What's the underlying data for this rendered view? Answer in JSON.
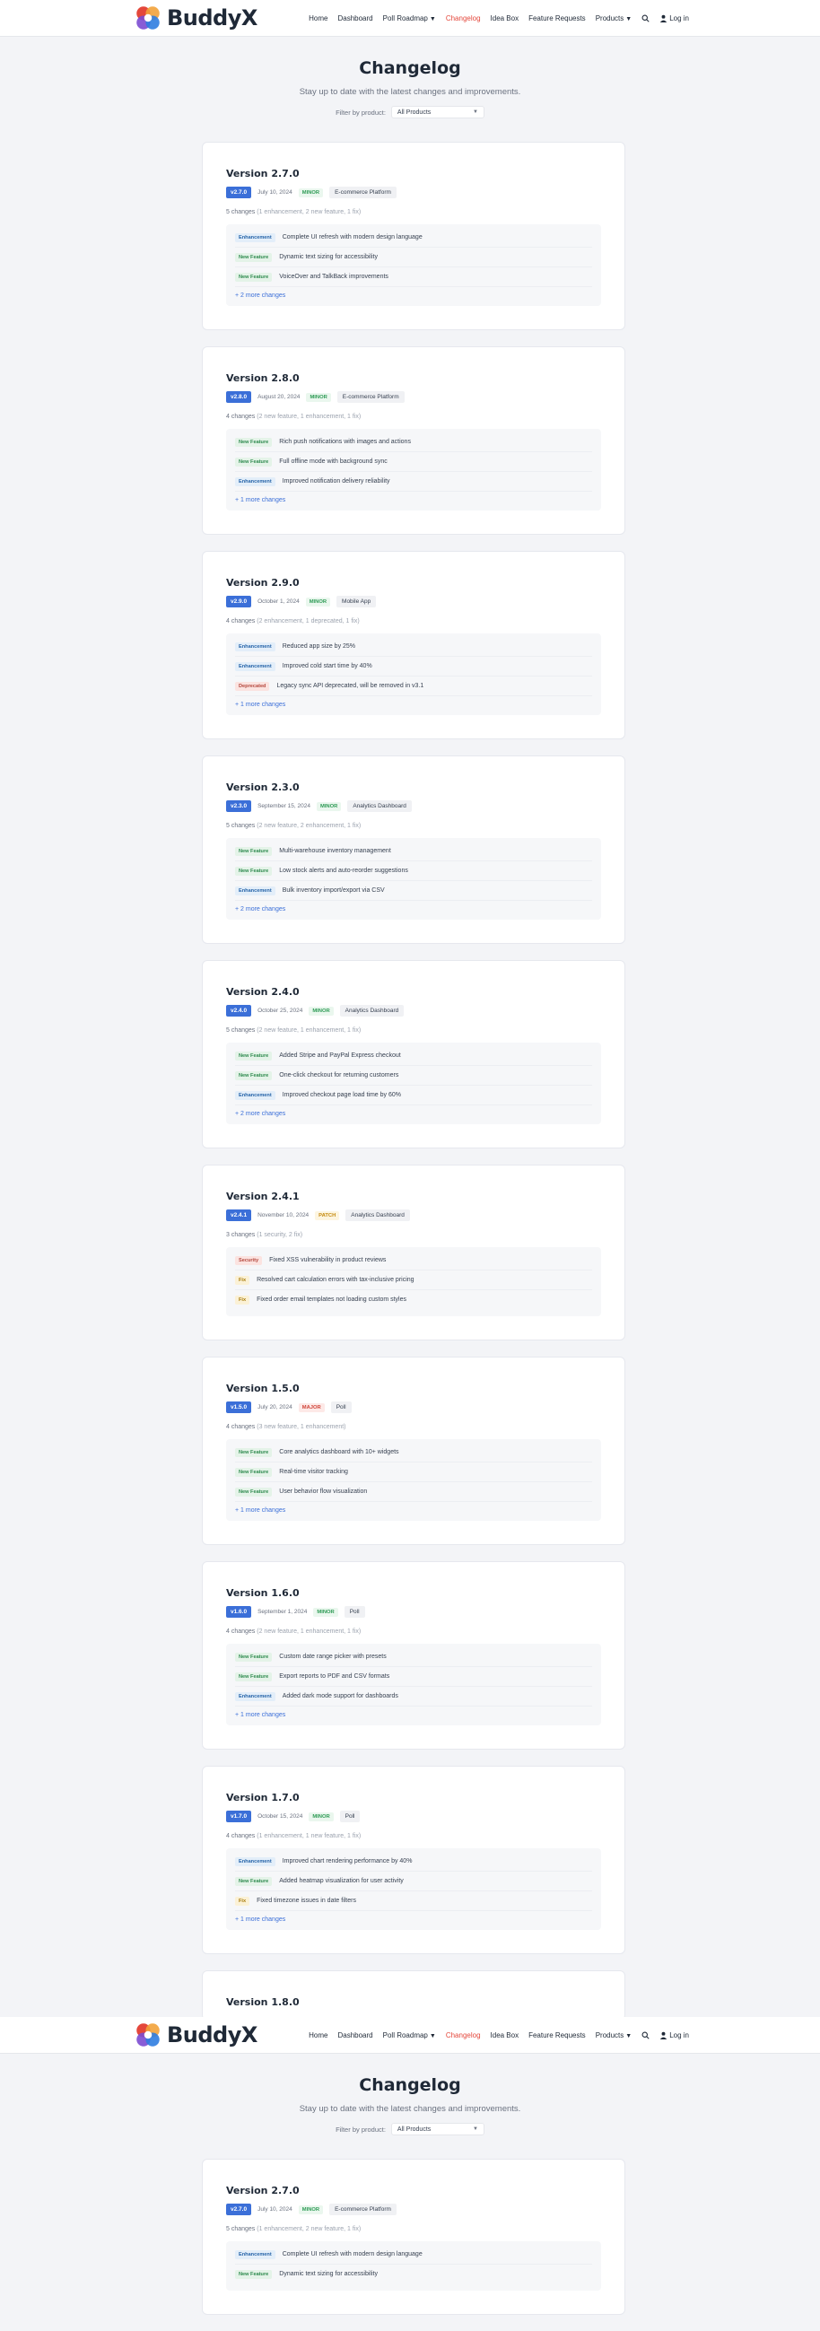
{
  "brand": {
    "name": "BuddyX"
  },
  "nav": {
    "items": [
      {
        "label": "Home"
      },
      {
        "label": "Dashboard"
      },
      {
        "label": "Poll Roadmap"
      },
      {
        "label": "Changelog"
      },
      {
        "label": "Idea Box"
      },
      {
        "label": "Feature Requests"
      },
      {
        "label": "Products"
      }
    ],
    "login": "Log in"
  },
  "page": {
    "title": "Changelog",
    "subtitle": "Stay up to date with the latest changes and improvements.",
    "filter_label": "Filter by product:",
    "filter_value": "All Products"
  },
  "cards": [
    {
      "title": "Version 2.7.0",
      "badge": "v2.7.0",
      "date": "July 10, 2024",
      "type": "MINOR",
      "product": "E-commerce Platform",
      "summary": "5 changes",
      "summary_detail": "(1 enhancement, 2 new feature, 1 fix)",
      "changes": [
        {
          "tag": "Enhancement",
          "text": "Complete UI refresh with modern design language"
        },
        {
          "tag": "New Feature",
          "text": "Dynamic text sizing for accessibility"
        },
        {
          "tag": "New Feature",
          "text": "VoiceOver and TalkBack improvements"
        }
      ],
      "more": "+ 2 more changes"
    },
    {
      "title": "Version 2.8.0",
      "badge": "v2.8.0",
      "date": "August 20, 2024",
      "type": "MINOR",
      "product": "E-commerce Platform",
      "summary": "4 changes",
      "summary_detail": "(2 new feature, 1 enhancement, 1 fix)",
      "changes": [
        {
          "tag": "New Feature",
          "text": "Rich push notifications with images and actions"
        },
        {
          "tag": "New Feature",
          "text": "Full offline mode with background sync"
        },
        {
          "tag": "Enhancement",
          "text": "Improved notification delivery reliability"
        }
      ],
      "more": "+ 1 more changes"
    },
    {
      "title": "Version 2.9.0",
      "badge": "v2.9.0",
      "date": "October 1, 2024",
      "type": "MINOR",
      "product": "Mobile App",
      "summary": "4 changes",
      "summary_detail": "(2 enhancement, 1 deprecated, 1 fix)",
      "changes": [
        {
          "tag": "Enhancement",
          "text": "Reduced app size by 25%"
        },
        {
          "tag": "Enhancement",
          "text": "Improved cold start time by 40%"
        },
        {
          "tag": "Deprecated",
          "text": "Legacy sync API deprecated, will be removed in v3.1"
        }
      ],
      "more": "+ 1 more changes"
    },
    {
      "title": "Version 2.3.0",
      "badge": "v2.3.0",
      "date": "September 15, 2024",
      "type": "MINOR",
      "product": "Analytics Dashboard",
      "summary": "5 changes",
      "summary_detail": "(2 new feature, 2 enhancement, 1 fix)",
      "changes": [
        {
          "tag": "New Feature",
          "text": "Multi-warehouse inventory management"
        },
        {
          "tag": "New Feature",
          "text": "Low stock alerts and auto-reorder suggestions"
        },
        {
          "tag": "Enhancement",
          "text": "Bulk inventory import/export via CSV"
        }
      ],
      "more": "+ 2 more changes"
    },
    {
      "title": "Version 2.4.0",
      "badge": "v2.4.0",
      "date": "October 25, 2024",
      "type": "MINOR",
      "product": "Analytics Dashboard",
      "summary": "5 changes",
      "summary_detail": "(2 new feature, 1 enhancement, 1 fix)",
      "changes": [
        {
          "tag": "New Feature",
          "text": "Added Stripe and PayPal Express checkout"
        },
        {
          "tag": "New Feature",
          "text": "One-click checkout for returning customers"
        },
        {
          "tag": "Enhancement",
          "text": "Improved checkout page load time by 60%"
        }
      ],
      "more": "+ 2 more changes"
    },
    {
      "title": "Version 2.4.1",
      "badge": "v2.4.1",
      "date": "November 10, 2024",
      "type": "PATCH",
      "product": "Analytics Dashboard",
      "summary": "3 changes",
      "summary_detail": "(1 security, 2 fix)",
      "changes": [
        {
          "tag": "Security",
          "text": "Fixed XSS vulnerability in product reviews"
        },
        {
          "tag": "Fix",
          "text": "Resolved cart calculation errors with tax-inclusive pricing"
        },
        {
          "tag": "Fix",
          "text": "Fixed order email templates not loading custom styles"
        }
      ],
      "more": ""
    },
    {
      "title": "Version 1.5.0",
      "badge": "v1.5.0",
      "date": "July 20, 2024",
      "type": "MAJOR",
      "product": "Poll",
      "summary": "4 changes",
      "summary_detail": "(3 new feature, 1 enhancement)",
      "changes": [
        {
          "tag": "New Feature",
          "text": "Core analytics dashboard with 10+ widgets"
        },
        {
          "tag": "New Feature",
          "text": "Real-time visitor tracking"
        },
        {
          "tag": "New Feature",
          "text": "User behavior flow visualization"
        }
      ],
      "more": "+ 1 more changes"
    },
    {
      "title": "Version 1.6.0",
      "badge": "v1.6.0",
      "date": "September 1, 2024",
      "type": "MINOR",
      "product": "Poll",
      "summary": "4 changes",
      "summary_detail": "(2 new feature, 1 enhancement, 1 fix)",
      "changes": [
        {
          "tag": "New Feature",
          "text": "Custom date range picker with presets"
        },
        {
          "tag": "New Feature",
          "text": "Export reports to PDF and CSV formats"
        },
        {
          "tag": "Enhancement",
          "text": "Added dark mode support for dashboards"
        }
      ],
      "more": "+ 1 more changes"
    },
    {
      "title": "Version 1.7.0",
      "badge": "v1.7.0",
      "date": "October 15, 2024",
      "type": "MINOR",
      "product": "Poll",
      "summary": "4 changes",
      "summary_detail": "(1 enhancement, 1 new feature, 1 fix)",
      "changes": [
        {
          "tag": "Enhancement",
          "text": "Improved chart rendering performance by 40%"
        },
        {
          "tag": "New Feature",
          "text": "Added heatmap visualization for user activity"
        },
        {
          "tag": "Fix",
          "text": "Fixed timezone issues in date filters"
        }
      ],
      "more": "+ 1 more changes"
    }
  ],
  "partial_card": {
    "title": "Version 1.8.0"
  },
  "repeat": {
    "card": {
      "title": "Version 2.7.0",
      "badge": "v2.7.0",
      "date": "July 10, 2024",
      "type": "MINOR",
      "product": "E-commerce Platform",
      "summary": "5 changes",
      "summary_detail": "(1 enhancement, 2 new feature, 1 fix)",
      "changes": [
        {
          "tag": "Enhancement",
          "text": "Complete UI refresh with modern design language"
        },
        {
          "tag": "New Feature",
          "text": "Dynamic text sizing for accessibility"
        }
      ]
    }
  }
}
